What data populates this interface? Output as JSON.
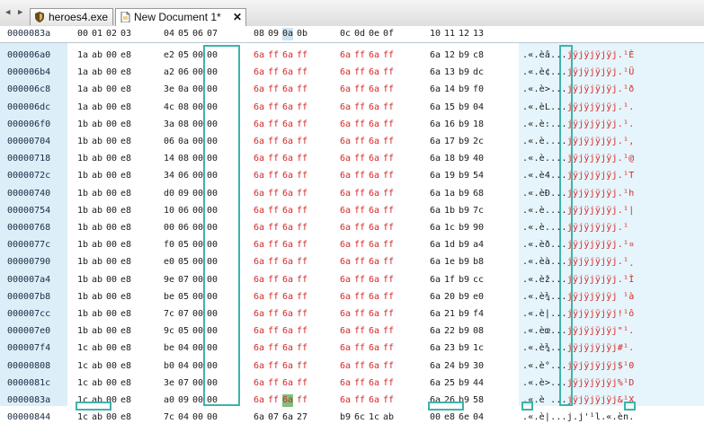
{
  "tabs": [
    {
      "label": "heroes4.exe",
      "icon": "shield-icon",
      "active": false
    },
    {
      "label": "New Document 1*",
      "icon": "document-icon",
      "active": true
    }
  ],
  "close_glyph": "✕",
  "nav_left": "◀",
  "nav_right": "▶",
  "header": {
    "offset": "0000083a",
    "columns": [
      "00",
      "01",
      "02",
      "03",
      "04",
      "05",
      "06",
      "07",
      "08",
      "09",
      "0a",
      "0b",
      "0c",
      "0d",
      "0e",
      "0f",
      "10",
      "11",
      "12",
      "13"
    ],
    "current_column": "0a"
  },
  "rows": [
    {
      "offset": "000006a0",
      "bytes": [
        "1a",
        "ab",
        "00",
        "e8",
        "e2",
        "05",
        "00",
        "00",
        "6a",
        "ff",
        "6a",
        "ff",
        "6a",
        "ff",
        "6a",
        "ff",
        "6a",
        "12",
        "b9",
        "c8"
      ],
      "ascii": ".«.èâ..."
    },
    {
      "offset": "000006b4",
      "bytes": [
        "1a",
        "ab",
        "00",
        "e8",
        "a2",
        "06",
        "00",
        "00",
        "6a",
        "ff",
        "6a",
        "ff",
        "6a",
        "ff",
        "6a",
        "ff",
        "6a",
        "13",
        "b9",
        "dc"
      ],
      "ascii": ".«.è¢..."
    },
    {
      "offset": "000006c8",
      "bytes": [
        "1a",
        "ab",
        "00",
        "e8",
        "3e",
        "0a",
        "00",
        "00",
        "6a",
        "ff",
        "6a",
        "ff",
        "6a",
        "ff",
        "6a",
        "ff",
        "6a",
        "14",
        "b9",
        "f0"
      ],
      "ascii": ".«.è>..."
    },
    {
      "offset": "000006dc",
      "bytes": [
        "1a",
        "ab",
        "00",
        "e8",
        "4c",
        "08",
        "00",
        "00",
        "6a",
        "ff",
        "6a",
        "ff",
        "6a",
        "ff",
        "6a",
        "ff",
        "6a",
        "15",
        "b9",
        "04"
      ],
      "ascii": ".«.èL..."
    },
    {
      "offset": "000006f0",
      "bytes": [
        "1b",
        "ab",
        "00",
        "e8",
        "3a",
        "08",
        "00",
        "00",
        "6a",
        "ff",
        "6a",
        "ff",
        "6a",
        "ff",
        "6a",
        "ff",
        "6a",
        "16",
        "b9",
        "18"
      ],
      "ascii": ".«.è:..."
    },
    {
      "offset": "00000704",
      "bytes": [
        "1b",
        "ab",
        "00",
        "e8",
        "06",
        "0a",
        "00",
        "00",
        "6a",
        "ff",
        "6a",
        "ff",
        "6a",
        "ff",
        "6a",
        "ff",
        "6a",
        "17",
        "b9",
        "2c"
      ],
      "ascii": ".«.è...."
    },
    {
      "offset": "00000718",
      "bytes": [
        "1b",
        "ab",
        "00",
        "e8",
        "14",
        "08",
        "00",
        "00",
        "6a",
        "ff",
        "6a",
        "ff",
        "6a",
        "ff",
        "6a",
        "ff",
        "6a",
        "18",
        "b9",
        "40"
      ],
      "ascii": ".«.è...."
    },
    {
      "offset": "0000072c",
      "bytes": [
        "1b",
        "ab",
        "00",
        "e8",
        "34",
        "06",
        "00",
        "00",
        "6a",
        "ff",
        "6a",
        "ff",
        "6a",
        "ff",
        "6a",
        "ff",
        "6a",
        "19",
        "b9",
        "54"
      ],
      "ascii": ".«.è4..."
    },
    {
      "offset": "00000740",
      "bytes": [
        "1b",
        "ab",
        "00",
        "e8",
        "d0",
        "09",
        "00",
        "00",
        "6a",
        "ff",
        "6a",
        "ff",
        "6a",
        "ff",
        "6a",
        "ff",
        "6a",
        "1a",
        "b9",
        "68"
      ],
      "ascii": ".«.èÐ..."
    },
    {
      "offset": "00000754",
      "bytes": [
        "1b",
        "ab",
        "00",
        "e8",
        "10",
        "06",
        "00",
        "00",
        "6a",
        "ff",
        "6a",
        "ff",
        "6a",
        "ff",
        "6a",
        "ff",
        "6a",
        "1b",
        "b9",
        "7c"
      ],
      "ascii": ".«.è...."
    },
    {
      "offset": "00000768",
      "bytes": [
        "1b",
        "ab",
        "00",
        "e8",
        "00",
        "06",
        "00",
        "00",
        "6a",
        "ff",
        "6a",
        "ff",
        "6a",
        "ff",
        "6a",
        "ff",
        "6a",
        "1c",
        "b9",
        "90"
      ],
      "ascii": ".«.è...."
    },
    {
      "offset": "0000077c",
      "bytes": [
        "1b",
        "ab",
        "00",
        "e8",
        "f0",
        "05",
        "00",
        "00",
        "6a",
        "ff",
        "6a",
        "ff",
        "6a",
        "ff",
        "6a",
        "ff",
        "6a",
        "1d",
        "b9",
        "a4"
      ],
      "ascii": ".«.èð..."
    },
    {
      "offset": "00000790",
      "bytes": [
        "1b",
        "ab",
        "00",
        "e8",
        "e0",
        "05",
        "00",
        "00",
        "6a",
        "ff",
        "6a",
        "ff",
        "6a",
        "ff",
        "6a",
        "ff",
        "6a",
        "1e",
        "b9",
        "b8"
      ],
      "ascii": ".«.èà..."
    },
    {
      "offset": "000007a4",
      "bytes": [
        "1b",
        "ab",
        "00",
        "e8",
        "9e",
        "07",
        "00",
        "00",
        "6a",
        "ff",
        "6a",
        "ff",
        "6a",
        "ff",
        "6a",
        "ff",
        "6a",
        "1f",
        "b9",
        "cc"
      ],
      "ascii": ".«.èž..."
    },
    {
      "offset": "000007b8",
      "bytes": [
        "1b",
        "ab",
        "00",
        "e8",
        "be",
        "05",
        "00",
        "00",
        "6a",
        "ff",
        "6a",
        "ff",
        "6a",
        "ff",
        "6a",
        "ff",
        "6a",
        "20",
        "b9",
        "e0"
      ],
      "ascii": ".«.è¾..."
    },
    {
      "offset": "000007cc",
      "bytes": [
        "1b",
        "ab",
        "00",
        "e8",
        "7c",
        "07",
        "00",
        "00",
        "6a",
        "ff",
        "6a",
        "ff",
        "6a",
        "ff",
        "6a",
        "ff",
        "6a",
        "21",
        "b9",
        "f4"
      ],
      "ascii": ".«.è|..."
    },
    {
      "offset": "000007e0",
      "bytes": [
        "1b",
        "ab",
        "00",
        "e8",
        "9c",
        "05",
        "00",
        "00",
        "6a",
        "ff",
        "6a",
        "ff",
        "6a",
        "ff",
        "6a",
        "ff",
        "6a",
        "22",
        "b9",
        "08"
      ],
      "ascii": ".«.èœ..."
    },
    {
      "offset": "000007f4",
      "bytes": [
        "1c",
        "ab",
        "00",
        "e8",
        "be",
        "04",
        "00",
        "00",
        "6a",
        "ff",
        "6a",
        "ff",
        "6a",
        "ff",
        "6a",
        "ff",
        "6a",
        "23",
        "b9",
        "1c"
      ],
      "ascii": ".«.è¾..."
    },
    {
      "offset": "00000808",
      "bytes": [
        "1c",
        "ab",
        "00",
        "e8",
        "b0",
        "04",
        "00",
        "00",
        "6a",
        "ff",
        "6a",
        "ff",
        "6a",
        "ff",
        "6a",
        "ff",
        "6a",
        "24",
        "b9",
        "30"
      ],
      "ascii": ".«.è°..."
    },
    {
      "offset": "0000081c",
      "bytes": [
        "1c",
        "ab",
        "00",
        "e8",
        "3e",
        "07",
        "00",
        "00",
        "6a",
        "ff",
        "6a",
        "ff",
        "6a",
        "ff",
        "6a",
        "ff",
        "6a",
        "25",
        "b9",
        "44"
      ],
      "ascii": ".«.è>..."
    },
    {
      "offset": "0000083a",
      "bytes": [
        "1c",
        "ab",
        "00",
        "e8",
        "a0",
        "09",
        "00",
        "00",
        "6a",
        "ff",
        "6a",
        "ff",
        "6a",
        "ff",
        "6a",
        "ff",
        "6a",
        "26",
        "b9",
        "58"
      ],
      "ascii": ".«.è ..."
    },
    {
      "offset": "00000844",
      "bytes": [
        "1c",
        "ab",
        "00",
        "e8",
        "7c",
        "04",
        "00",
        "00",
        "6a",
        "07",
        "6a",
        "27",
        "b9",
        "6c",
        "1c",
        "ab",
        "00",
        "e8",
        "6e",
        "04"
      ],
      "ascii": ".«.è|..."
    }
  ],
  "ascii_tail": [
    "jÿjÿjÿjÿj.¹È",
    "jÿjÿjÿjÿj.¹Ü",
    "jÿjÿjÿjÿj.¹ð",
    "jÿjÿjÿjÿj.¹.",
    "jÿjÿjÿjÿj.¹.",
    "jÿjÿjÿjÿj.¹,",
    "jÿjÿjÿjÿj.¹@",
    "jÿjÿjÿjÿj.¹T",
    "jÿjÿjÿjÿj.¹h",
    "jÿjÿjÿjÿj.¹|",
    "jÿjÿjÿjÿj.¹",
    "jÿjÿjÿjÿj.¹¤",
    "jÿjÿjÿjÿj.¹¸",
    "jÿjÿjÿjÿj.¹Ì",
    "jÿjÿjÿjÿj ¹à",
    "jÿjÿjÿjÿj!¹ô",
    "jÿjÿjÿjÿj\"¹.",
    "jÿjÿjÿjÿj#¹.",
    "jÿjÿjÿjÿj$¹0",
    "jÿjÿjÿjÿj%¹D",
    "jÿjÿjÿjÿj&¹X",
    "j.j'¹l.«.èn."
  ],
  "selection": {
    "row": 20,
    "byte": 10
  },
  "colors": {
    "offset_bg": "#dceef7",
    "ascii_bg": "#e6f5fb",
    "ff_red": "#d62828",
    "highlight_box": "#3fb3a9",
    "selected": "#7fbf7f"
  }
}
